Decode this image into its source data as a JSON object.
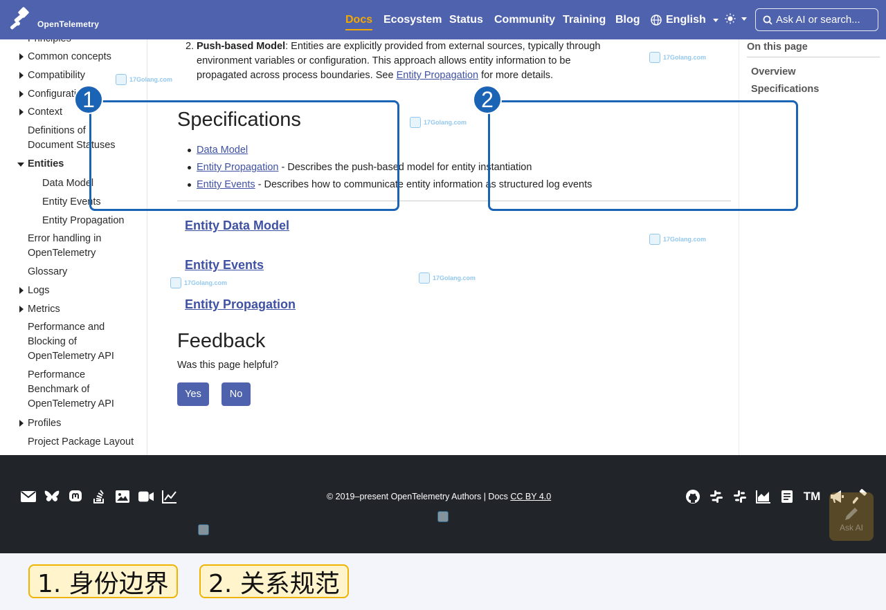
{
  "brand": {
    "name": "OpenTelemetry"
  },
  "nav": {
    "items": [
      {
        "label": "Docs",
        "active": true
      },
      {
        "label": "Ecosystem"
      },
      {
        "label": "Status"
      },
      {
        "label": "Community"
      },
      {
        "label": "Training"
      },
      {
        "label": "Blog"
      }
    ],
    "language": "English",
    "search_placeholder": "Ask AI or search..."
  },
  "sidebar": {
    "items": [
      {
        "label": "Principles"
      },
      {
        "label": "Common concepts"
      },
      {
        "label": "Compatibility"
      },
      {
        "label": "Configuration"
      },
      {
        "label": "Context"
      },
      {
        "label": "Definitions of"
      },
      {
        "label": "Document Statuses"
      },
      {
        "label": "Entities"
      },
      {
        "label": "Data Model"
      },
      {
        "label": "Entity Events"
      },
      {
        "label": "Entity Propagation"
      },
      {
        "label": "Error handling in"
      },
      {
        "label": "OpenTelemetry"
      },
      {
        "label": "Glossary"
      },
      {
        "label": "Logs"
      },
      {
        "label": "Metrics"
      },
      {
        "label": "Performance and"
      },
      {
        "label": "Blocking of"
      },
      {
        "label": "OpenTelemetry API"
      },
      {
        "label": "Performance"
      },
      {
        "label": "Benchmark of"
      },
      {
        "label": "OpenTelemetry API"
      },
      {
        "label": "Profiles"
      },
      {
        "label": "Project Package Layout"
      }
    ]
  },
  "main": {
    "intro": {
      "number": "2.",
      "bold": "Push-based Model",
      "text1": ": Entities are explicitly provided from external sources, typically through",
      "text2": "environment variables or configuration. This approach allows entity information to be",
      "text3": "propagated across process boundaries. See ",
      "link": "Entity Propagation",
      "text4": " for more details."
    },
    "spec_heading": "Specifications",
    "spec_list": [
      {
        "link": "Data Model",
        "desc": ""
      },
      {
        "link": "Entity Propagation",
        "desc": " - Describes the push-based model for entity instantiation"
      },
      {
        "link": "Entity Events",
        "desc": " - Describes how to communicate entity information as structured log events"
      }
    ],
    "sub_headings": [
      "Entity Data Model",
      "Entity Events",
      "Entity Propagation"
    ],
    "feedback_heading": "Feedback",
    "feedback_question": "Was this page helpful?",
    "yes_label": "Yes",
    "no_label": "No"
  },
  "toc": {
    "title": "On this page",
    "items": [
      "Overview",
      "Specifications"
    ]
  },
  "callouts": {
    "one": "1",
    "two": "2"
  },
  "watermark": "17Golang.com",
  "footer": {
    "copyright": "© 2019–present  OpenTelemetry Authors | Docs ",
    "license": "CC BY 4.0",
    "left_icons": [
      "mail-icon",
      "bluesky-icon",
      "mastodon-icon",
      "stackoverflow-icon",
      "image-icon",
      "video-icon",
      "chart-icon"
    ],
    "right_icons": [
      "github-icon",
      "slack-icon",
      "slack-icon",
      "graph-icon",
      "book-icon",
      "trademark-icon",
      "megaphone-icon",
      "hammer-icon"
    ],
    "tm_text": "TM",
    "ask_ai": "Ask AI"
  },
  "captions": [
    "1. 身份边界",
    "2. 关系规范"
  ],
  "colors": {
    "nav_bg": "#4f62ad",
    "accent": "#f5a800",
    "link": "#3f51a3",
    "callout": "#1b63b5",
    "footer_bg": "#212529"
  }
}
